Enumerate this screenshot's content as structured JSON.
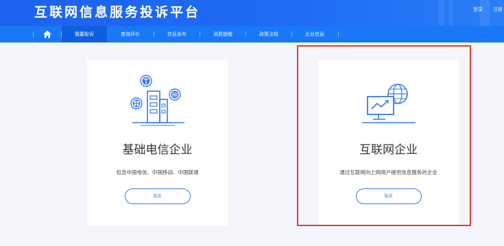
{
  "header": {
    "title": "互联网信息服务投诉平台",
    "login": "登录",
    "register": "注册"
  },
  "nav": {
    "home_icon": "home-icon",
    "items": [
      "我要投诉",
      "查询评价",
      "信息发布",
      "消费提醒",
      "政策法规",
      "企业信息"
    ],
    "active_index": 0
  },
  "cards": [
    {
      "illustration": "telecom-building-icon",
      "title": "基础电信企业",
      "description": "包含中国电信、中国移动、中国联通",
      "button": "投诉"
    },
    {
      "illustration": "internet-monitor-globe-icon",
      "title": "互联网企业",
      "description": "通过互联网向上网用户提供信息服务的企业",
      "button": "投诉"
    }
  ],
  "colors": {
    "header": "#1e62f0",
    "nav": "#1878f6",
    "active_tab": "#0d5fe0",
    "accent": "#3a78e6",
    "highlight": "#e53935",
    "background": "#f3f5fa"
  }
}
